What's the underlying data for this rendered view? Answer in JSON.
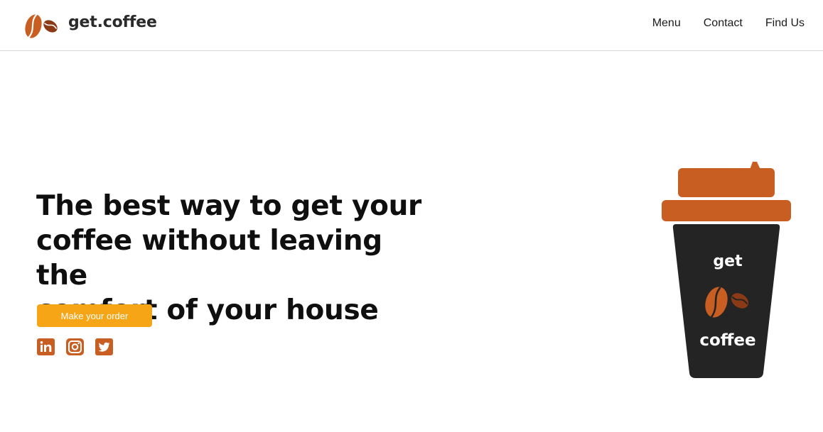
{
  "brand": {
    "name": "get.coffee"
  },
  "nav": {
    "items": [
      {
        "label": "Menu"
      },
      {
        "label": "Contact"
      },
      {
        "label": "Find Us"
      }
    ]
  },
  "hero": {
    "headline_lines": [
      "The best way to get your",
      "coffee without leaving the",
      "comfort of your house"
    ],
    "cta_label": "Make your order"
  },
  "socials": [
    {
      "icon": "linkedin-icon"
    },
    {
      "icon": "instagram-icon"
    },
    {
      "icon": "twitter-icon"
    }
  ],
  "cup": {
    "top_text": "get",
    "bottom_text": "coffee"
  },
  "colors": {
    "accent_orange": "#C95E22",
    "button_orange": "#F6A516",
    "cup_dark": "#242424",
    "bean_dark": "#8A3A14"
  }
}
